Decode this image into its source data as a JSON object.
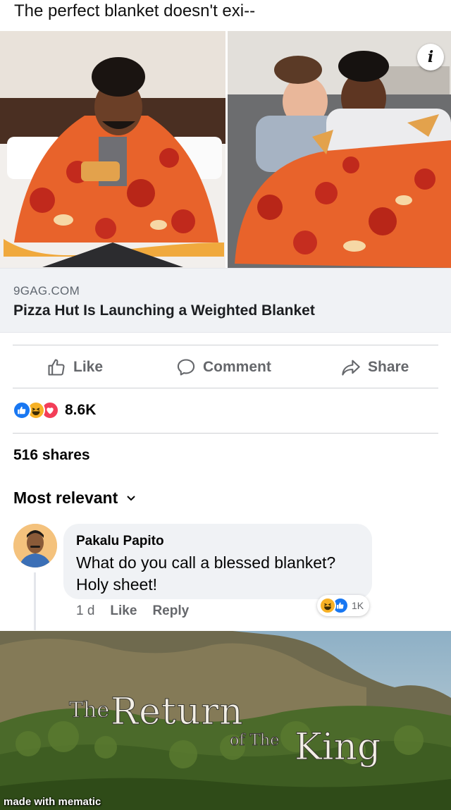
{
  "caption": "The perfect blanket doesn't exi--",
  "post": {
    "link": {
      "domain": "9GAG.COM",
      "title": "Pizza Hut Is Launching a Weighted Blanket"
    },
    "actions": {
      "like": "Like",
      "comment": "Comment",
      "share": "Share"
    },
    "reactions": {
      "types": [
        "like",
        "haha",
        "love"
      ],
      "count": "8.6K"
    },
    "shares": "516 shares",
    "sort_label": "Most relevant"
  },
  "comment": {
    "author": "Pakalu Papito",
    "line1": "What do you call a blessed blanket?",
    "line2": "Holy sheet!",
    "time": "1 d",
    "like": "Like",
    "reply": "Reply",
    "reaction_count": "1K"
  },
  "meme": {
    "title_the": "The",
    "title_return": "Return",
    "title_of_the": "of The",
    "title_king": "King",
    "watermark": "made with mematic"
  },
  "colors": {
    "facebook_blue": "#1877f2",
    "haha_yellow": "#f7b125",
    "love_red": "#f33e58",
    "secondary_text": "#65676b"
  }
}
